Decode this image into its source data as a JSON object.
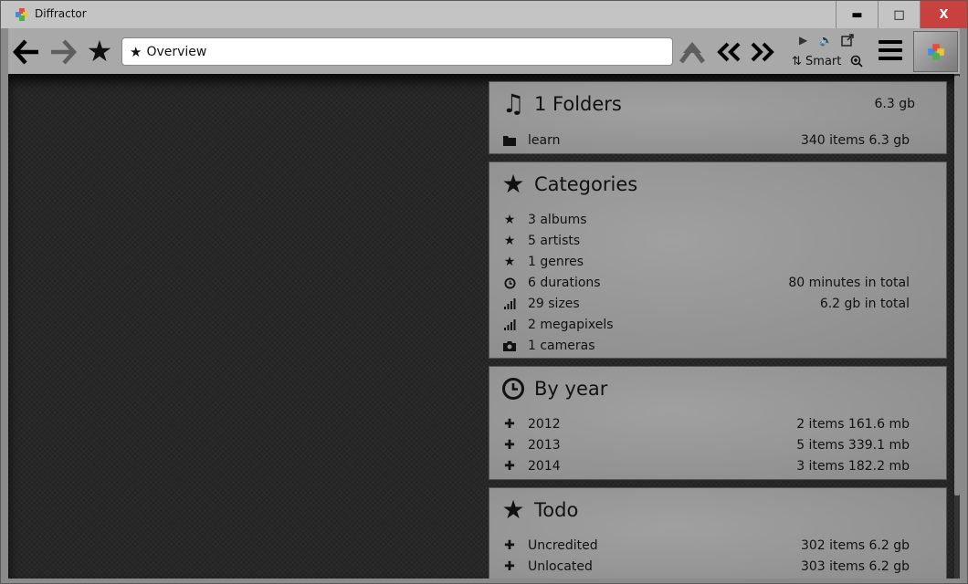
{
  "window": {
    "title": "Diffractor",
    "minimize": "▬",
    "maximize": "□",
    "close": "X"
  },
  "toolbar": {
    "address_value": "Overview",
    "sort_label": "⇅ Smart",
    "icons": [
      "back-arrow-icon",
      "forward-arrow-icon",
      "star-icon",
      "up-arrow-icon",
      "double-left-icon",
      "double-right-icon",
      "play-icon",
      "volume-icon",
      "external-icon",
      "zoom-in-icon",
      "menu-icon"
    ]
  },
  "panels": {
    "folders": {
      "title": "1 Folders",
      "total": "6.3 gb",
      "rows": [
        {
          "label": "learn",
          "value": "340 items 6.3 gb",
          "icon": "folder-icon"
        }
      ]
    },
    "categories": {
      "title": "Categories",
      "rows": [
        {
          "label": "3 albums",
          "value": "",
          "icon": "star-icon"
        },
        {
          "label": "5 artists",
          "value": "",
          "icon": "star-icon"
        },
        {
          "label": "1 genres",
          "value": "",
          "icon": "star-icon"
        },
        {
          "label": "6 durations",
          "value": "80 minutes in total",
          "icon": "clock-icon"
        },
        {
          "label": "29 sizes",
          "value": "6.2 gb in total",
          "icon": "signal-icon"
        },
        {
          "label": "2 megapixels",
          "value": "",
          "icon": "signal-icon"
        },
        {
          "label": "1 cameras",
          "value": "",
          "icon": "camera-icon"
        }
      ]
    },
    "by_year": {
      "title": "By year",
      "rows": [
        {
          "label": "2012",
          "value": "2 items 161.6 mb",
          "icon": "plus-icon"
        },
        {
          "label": "2013",
          "value": "5 items 339.1 mb",
          "icon": "plus-icon"
        },
        {
          "label": "2014",
          "value": "3 items 182.2 mb",
          "icon": "plus-icon"
        }
      ]
    },
    "todo": {
      "title": "Todo",
      "rows": [
        {
          "label": "Uncredited",
          "value": "302 items 6.2 gb",
          "icon": "plus-icon"
        },
        {
          "label": "Unlocated",
          "value": "303 items 6.2 gb",
          "icon": "plus-icon"
        }
      ]
    }
  },
  "colors": {
    "close_red": "#c8413e",
    "panel_gray": "#939393",
    "content_bg": "#222222"
  }
}
